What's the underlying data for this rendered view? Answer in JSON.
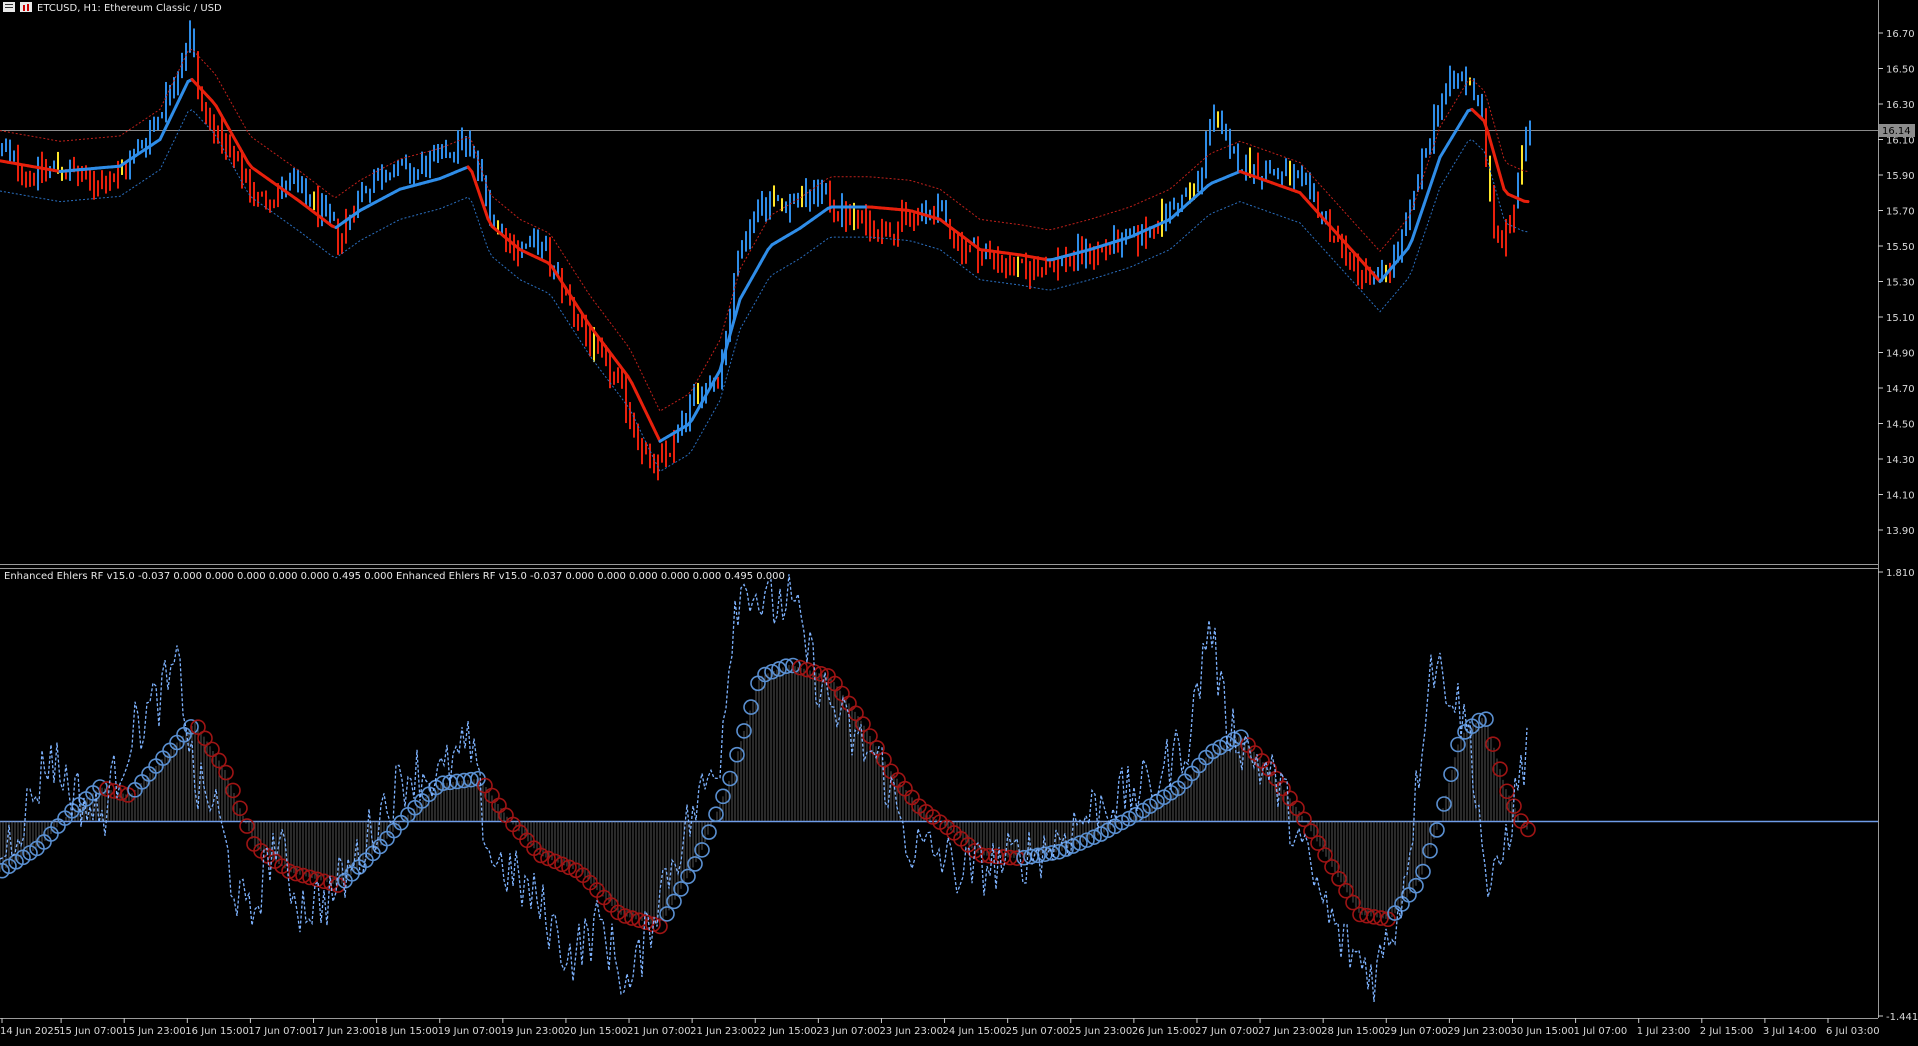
{
  "window": {
    "title": "ETCUSD, H1:  Ethereum Classic / USD",
    "indicator_text": "Enhanced Ehlers RF v15.0 -0.037 0.000 0.000 0.000 0.000 0.000 0.495 0.000 Enhanced Ehlers RF v15.0 -0.037 0.000 0.000 0.000 0.000 0.000 0.495 0.000"
  },
  "colors": {
    "background": "#000000",
    "bull": "#2f8de8",
    "bear": "#e8200c",
    "signal": "#ffe62a",
    "osc_up": "#5a8fd0",
    "osc_down": "#9e1414",
    "zero_line": "#6f9ce8",
    "dotted": "#7eb3ff",
    "grid": "#7a7a7a"
  },
  "price_pane": {
    "symbol": "ETCUSD",
    "timeframe": "H1",
    "current_price": "16.14",
    "price_axis_labels": [
      "16.70",
      "16.50",
      "16.30",
      "16.10",
      "15.90",
      "15.70",
      "15.50",
      "15.30",
      "15.10",
      "14.90",
      "14.70",
      "14.50",
      "14.30",
      "14.10",
      "13.90"
    ]
  },
  "indicator_pane": {
    "name": "Enhanced Ehlers RF v15.0",
    "axis_top": "1.810",
    "axis_bottom": "-1.441"
  },
  "time_axis": {
    "labels": [
      "14 Jun 2025",
      "15 Jun 07:00",
      "15 Jun 23:00",
      "16 Jun 15:00",
      "17 Jun 07:00",
      "17 Jun 23:00",
      "18 Jun 15:00",
      "19 Jun 07:00",
      "19 Jun 23:00",
      "20 Jun 15:00",
      "21 Jun 07:00",
      "21 Jun 23:00",
      "22 Jun 15:00",
      "23 Jun 07:00",
      "23 Jun 23:00",
      "24 Jun 15:00",
      "25 Jun 07:00",
      "25 Jun 23:00",
      "26 Jun 15:00",
      "27 Jun 07:00",
      "27 Jun 23:00",
      "28 Jun 15:00",
      "29 Jun 07:00",
      "29 Jun 23:00",
      "30 Jun 15:00",
      "1 Jul 07:00",
      "1 Jul 23:00",
      "2 Jul 15:00",
      "3 Jul 14:00",
      "6 Jul 03:00"
    ]
  },
  "chart_data": {
    "type": "line",
    "title": "ETCUSD, H1:  Ethereum Classic / USD",
    "ylim": [
      13.8,
      16.85
    ],
    "price_path": [
      [
        0,
        16.05
      ],
      [
        30,
        15.9
      ],
      [
        60,
        15.95
      ],
      [
        90,
        15.85
      ],
      [
        120,
        15.9
      ],
      [
        150,
        16.15
      ],
      [
        175,
        16.45
      ],
      [
        190,
        16.7
      ],
      [
        200,
        16.3
      ],
      [
        230,
        16.0
      ],
      [
        260,
        15.75
      ],
      [
        290,
        15.85
      ],
      [
        320,
        15.7
      ],
      [
        340,
        15.55
      ],
      [
        360,
        15.8
      ],
      [
        390,
        15.95
      ],
      [
        410,
        15.9
      ],
      [
        440,
        16.0
      ],
      [
        460,
        16.1
      ],
      [
        475,
        16.0
      ],
      [
        490,
        15.7
      ],
      [
        510,
        15.5
      ],
      [
        540,
        15.5
      ],
      [
        560,
        15.3
      ],
      [
        590,
        14.95
      ],
      [
        620,
        14.7
      ],
      [
        650,
        14.25
      ],
      [
        665,
        14.3
      ],
      [
        690,
        14.6
      ],
      [
        720,
        14.8
      ],
      [
        740,
        15.5
      ],
      [
        760,
        15.75
      ],
      [
        790,
        15.75
      ],
      [
        820,
        15.8
      ],
      [
        850,
        15.65
      ],
      [
        880,
        15.6
      ],
      [
        910,
        15.65
      ],
      [
        940,
        15.7
      ],
      [
        960,
        15.5
      ],
      [
        990,
        15.45
      ],
      [
        1020,
        15.35
      ],
      [
        1050,
        15.4
      ],
      [
        1080,
        15.45
      ],
      [
        1110,
        15.5
      ],
      [
        1140,
        15.55
      ],
      [
        1170,
        15.7
      ],
      [
        1200,
        15.85
      ],
      [
        1212,
        16.3
      ],
      [
        1230,
        16.0
      ],
      [
        1250,
        15.95
      ],
      [
        1280,
        15.9
      ],
      [
        1300,
        15.85
      ],
      [
        1320,
        15.7
      ],
      [
        1350,
        15.4
      ],
      [
        1380,
        15.3
      ],
      [
        1400,
        15.5
      ],
      [
        1420,
        15.9
      ],
      [
        1440,
        16.35
      ],
      [
        1460,
        16.45
      ],
      [
        1480,
        16.35
      ],
      [
        1495,
        15.5
      ],
      [
        1510,
        15.6
      ],
      [
        1525,
        16.1
      ]
    ],
    "rf_line_path": [
      [
        0,
        15.98
      ],
      [
        60,
        15.92
      ],
      [
        120,
        15.95
      ],
      [
        160,
        16.1
      ],
      [
        190,
        16.45
      ],
      [
        215,
        16.3
      ],
      [
        250,
        15.95
      ],
      [
        300,
        15.75
      ],
      [
        335,
        15.6
      ],
      [
        360,
        15.7
      ],
      [
        400,
        15.82
      ],
      [
        440,
        15.88
      ],
      [
        470,
        15.95
      ],
      [
        490,
        15.62
      ],
      [
        520,
        15.48
      ],
      [
        550,
        15.4
      ],
      [
        590,
        15.05
      ],
      [
        630,
        14.75
      ],
      [
        660,
        14.4
      ],
      [
        690,
        14.5
      ],
      [
        720,
        14.8
      ],
      [
        740,
        15.2
      ],
      [
        770,
        15.5
      ],
      [
        800,
        15.6
      ],
      [
        830,
        15.72
      ],
      [
        870,
        15.72
      ],
      [
        910,
        15.7
      ],
      [
        940,
        15.65
      ],
      [
        980,
        15.48
      ],
      [
        1020,
        15.45
      ],
      [
        1050,
        15.42
      ],
      [
        1090,
        15.48
      ],
      [
        1130,
        15.55
      ],
      [
        1170,
        15.65
      ],
      [
        1210,
        15.85
      ],
      [
        1240,
        15.92
      ],
      [
        1275,
        15.85
      ],
      [
        1300,
        15.8
      ],
      [
        1340,
        15.55
      ],
      [
        1380,
        15.3
      ],
      [
        1410,
        15.5
      ],
      [
        1440,
        16.0
      ],
      [
        1470,
        16.28
      ],
      [
        1485,
        16.2
      ],
      [
        1505,
        15.8
      ],
      [
        1525,
        15.75
      ]
    ],
    "oscillator_ylim": [
      -1.441,
      1.81
    ],
    "oscillator_path": [
      [
        0,
        -0.3
      ],
      [
        40,
        -0.15
      ],
      [
        70,
        0.05
      ],
      [
        100,
        0.2
      ],
      [
        130,
        0.15
      ],
      [
        160,
        0.35
      ],
      [
        195,
        0.58
      ],
      [
        225,
        0.3
      ],
      [
        255,
        -0.15
      ],
      [
        290,
        -0.3
      ],
      [
        340,
        -0.38
      ],
      [
        380,
        -0.15
      ],
      [
        410,
        0.05
      ],
      [
        440,
        0.22
      ],
      [
        480,
        0.25
      ],
      [
        510,
        0.0
      ],
      [
        540,
        -0.2
      ],
      [
        580,
        -0.3
      ],
      [
        620,
        -0.55
      ],
      [
        660,
        -0.62
      ],
      [
        700,
        -0.2
      ],
      [
        730,
        0.25
      ],
      [
        760,
        0.85
      ],
      [
        790,
        0.92
      ],
      [
        830,
        0.85
      ],
      [
        860,
        0.6
      ],
      [
        890,
        0.3
      ],
      [
        920,
        0.08
      ],
      [
        950,
        -0.05
      ],
      [
        980,
        -0.2
      ],
      [
        1020,
        -0.22
      ],
      [
        1060,
        -0.18
      ],
      [
        1100,
        -0.08
      ],
      [
        1140,
        0.05
      ],
      [
        1180,
        0.2
      ],
      [
        1210,
        0.4
      ],
      [
        1240,
        0.5
      ],
      [
        1270,
        0.3
      ],
      [
        1300,
        0.05
      ],
      [
        1330,
        -0.25
      ],
      [
        1360,
        -0.55
      ],
      [
        1390,
        -0.58
      ],
      [
        1420,
        -0.35
      ],
      [
        1440,
        0.0
      ],
      [
        1460,
        0.5
      ],
      [
        1485,
        0.62
      ],
      [
        1505,
        0.2
      ],
      [
        1525,
        -0.05
      ]
    ],
    "raw_path": [
      [
        0,
        -0.2
      ],
      [
        30,
        0.1
      ],
      [
        50,
        0.4
      ],
      [
        70,
        0.2
      ],
      [
        100,
        0.0
      ],
      [
        130,
        0.5
      ],
      [
        150,
        0.65
      ],
      [
        180,
        0.9
      ],
      [
        195,
        0.2
      ],
      [
        215,
        0.1
      ],
      [
        235,
        -0.4
      ],
      [
        250,
        -0.6
      ],
      [
        275,
        -0.1
      ],
      [
        300,
        -0.5
      ],
      [
        330,
        -0.45
      ],
      [
        360,
        -0.2
      ],
      [
        380,
        0.05
      ],
      [
        410,
        0.3
      ],
      [
        440,
        0.25
      ],
      [
        470,
        0.45
      ],
      [
        490,
        -0.2
      ],
      [
        510,
        -0.3
      ],
      [
        540,
        -0.5
      ],
      [
        570,
        -0.8
      ],
      [
        600,
        -0.6
      ],
      [
        630,
        -1.0
      ],
      [
        660,
        -0.4
      ],
      [
        690,
        0.0
      ],
      [
        720,
        0.4
      ],
      [
        735,
        1.3
      ],
      [
        750,
        1.4
      ],
      [
        765,
        1.25
      ],
      [
        790,
        1.3
      ],
      [
        820,
        0.8
      ],
      [
        850,
        0.5
      ],
      [
        880,
        0.35
      ],
      [
        910,
        -0.15
      ],
      [
        940,
        -0.2
      ],
      [
        960,
        -0.3
      ],
      [
        1000,
        -0.25
      ],
      [
        1050,
        -0.15
      ],
      [
        1100,
        0.1
      ],
      [
        1150,
        0.2
      ],
      [
        1190,
        0.5
      ],
      [
        1210,
        1.2
      ],
      [
        1225,
        0.6
      ],
      [
        1250,
        0.4
      ],
      [
        1280,
        0.2
      ],
      [
        1310,
        -0.3
      ],
      [
        1340,
        -0.7
      ],
      [
        1375,
        -0.9
      ],
      [
        1400,
        -0.5
      ],
      [
        1415,
        0.1
      ],
      [
        1430,
        0.95
      ],
      [
        1450,
        0.8
      ],
      [
        1470,
        0.5
      ],
      [
        1490,
        -0.5
      ],
      [
        1510,
        0.0
      ],
      [
        1528,
        0.45
      ]
    ]
  }
}
